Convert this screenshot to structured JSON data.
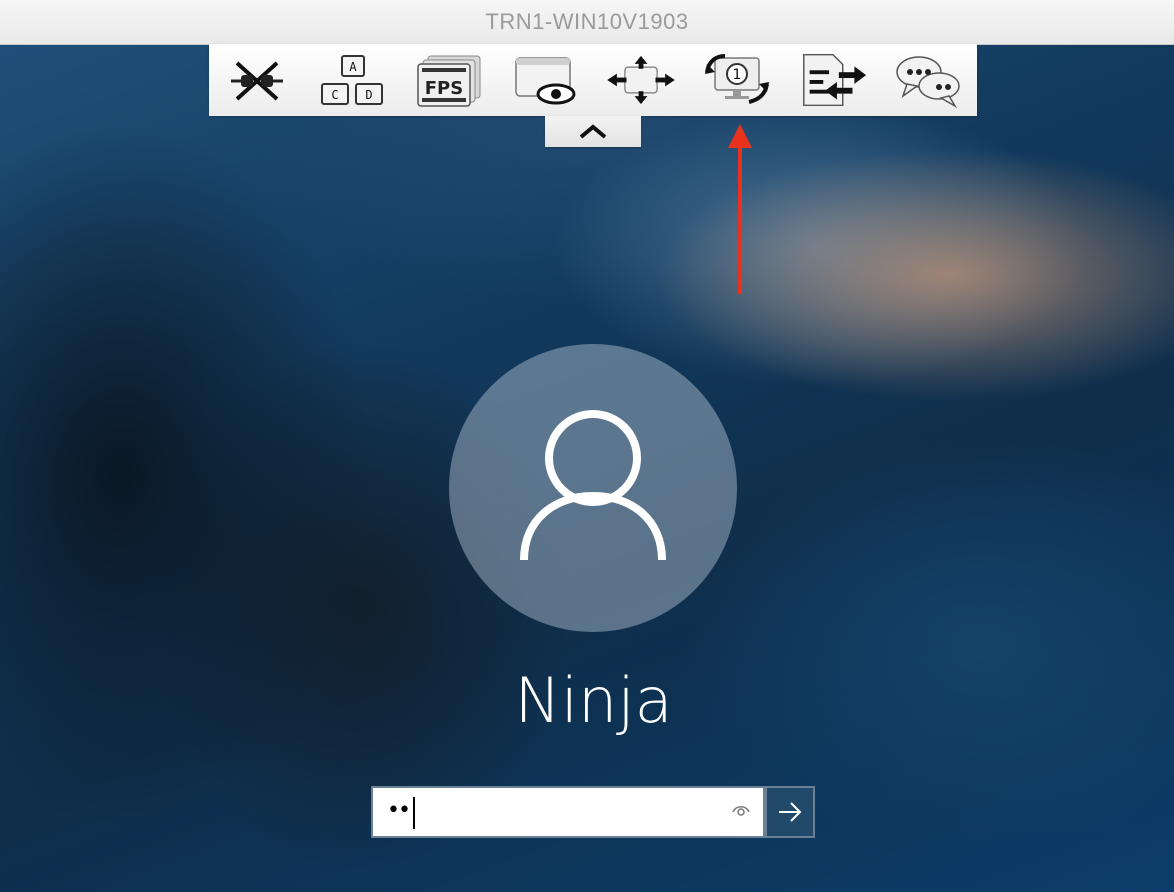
{
  "window": {
    "title": "TRN1-WIN10V1903"
  },
  "toolbar": {
    "items": [
      {
        "icon": "disconnect-icon"
      },
      {
        "icon": "keyboard-keys-icon",
        "keys": [
          "A",
          "C",
          "D"
        ]
      },
      {
        "icon": "fps-icon",
        "label": "FPS"
      },
      {
        "icon": "view-only-icon"
      },
      {
        "icon": "resize-arrows-icon"
      },
      {
        "icon": "switch-monitor-icon",
        "monitor_number": "1"
      },
      {
        "icon": "file-transfer-icon"
      },
      {
        "icon": "chat-icon"
      }
    ]
  },
  "annotation": {
    "color": "#e8321e"
  },
  "login": {
    "username": "Ninja",
    "password_value": "••"
  }
}
